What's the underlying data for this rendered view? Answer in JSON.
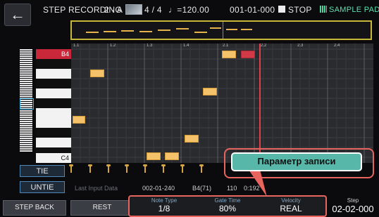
{
  "header": {
    "title": "STEP RECORDING",
    "track": "2 - A",
    "time_signature": "4 / 4",
    "tempo": "♩=120.00",
    "position": "001-01-000",
    "stop_label": "STOP",
    "pad_label": "SAMPLE PAD"
  },
  "keyboard": {
    "top_key": "B4",
    "bottom_key": "C4"
  },
  "grid": {
    "measures": [
      "1.1",
      "1.2",
      "1.3",
      "1.4",
      "2.1",
      "2.2",
      "2.3",
      "2.4"
    ]
  },
  "tie_controls": {
    "tie_label": "TIE",
    "untie_label": "UNTIE"
  },
  "last_input": {
    "label": "Last Input Data",
    "position": "002-01-240",
    "note": "B4(71)",
    "velocity": "110",
    "gate": "0:192"
  },
  "bottom_bar": {
    "step_back_label": "STEP BACK",
    "rest_label": "REST",
    "note_type_label": "Note Type",
    "note_type_value": "1/8",
    "gate_time_label": "Gate Time",
    "gate_time_value": "80%",
    "velocity_label": "Velocity",
    "velocity_value": "REAL",
    "step_label": "Step",
    "step_value": "02-02-000"
  },
  "callout": {
    "text": "Параметр записи"
  },
  "colors": {
    "note": "#f3c26b",
    "playhead": "#e0404c",
    "highlight": "#e8645e",
    "callout_bg": "#57b7a8",
    "overview_border": "#c8b83a"
  }
}
